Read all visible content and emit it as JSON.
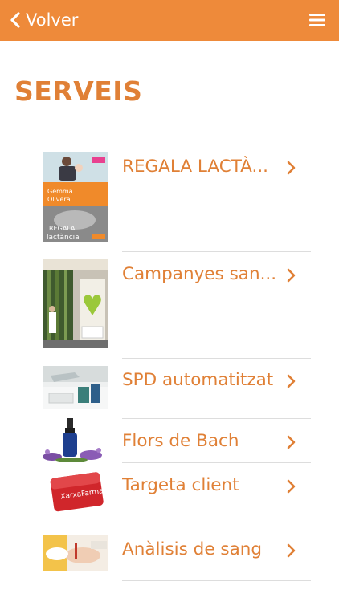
{
  "header": {
    "back_label": "Volver",
    "back_icon": "chevron-left-icon",
    "menu_icon": "hamburger-menu-icon",
    "bar_color": "#ee8a3a"
  },
  "page": {
    "title": "SERVEIS",
    "accent_color": "#e08036"
  },
  "services": [
    {
      "label": "REGALA LACTÀ...",
      "thumb_text": [
        "Gemma",
        "Olivera",
        "REGALA",
        "lactància"
      ]
    },
    {
      "label": "Campanyes san..."
    },
    {
      "label": "SPD automatitzat"
    },
    {
      "label": "Flors de Bach"
    },
    {
      "label": "Targeta client",
      "thumb_text": [
        "XarxaFarma"
      ]
    },
    {
      "label": "Anàlisis de sang"
    }
  ]
}
